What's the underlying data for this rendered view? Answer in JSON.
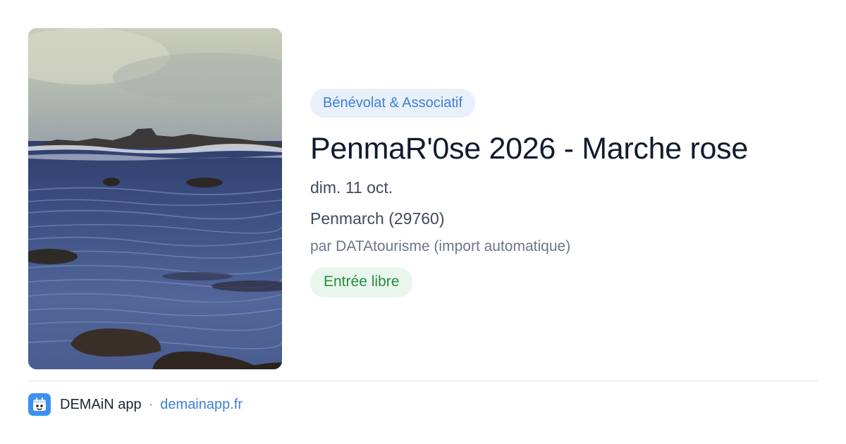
{
  "event": {
    "category": "Bénévolat & Associatif",
    "title": "PenmaR'0se 2026 - Marche rose",
    "date": "dim. 11 oct.",
    "location": "Penmarch (29760)",
    "author": "par DATAtourisme (import automatique)",
    "price": "Entrée libre",
    "image_alt": "Photo of a rocky coastline at low tide with a calm sea"
  },
  "footer": {
    "app_name": "DEMAiN app",
    "separator": "·",
    "site": "demainapp.fr",
    "icon": "calendar-robot-icon"
  },
  "colors": {
    "accent": "#3d7fd0",
    "category_bg": "#e8f0fb",
    "price_text": "#2a8a43",
    "price_bg": "#e9f6ec",
    "title": "#111a2e",
    "icon_bg": "#3b8ff0"
  }
}
